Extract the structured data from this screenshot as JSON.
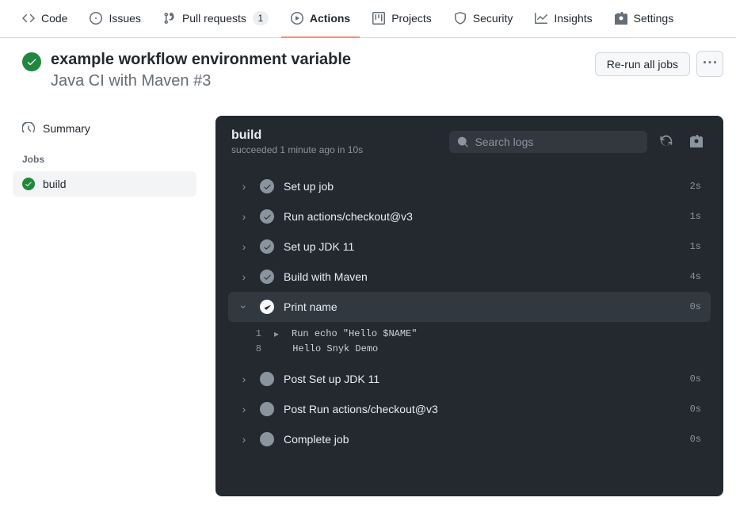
{
  "nav": {
    "code": "Code",
    "issues": "Issues",
    "pulls": "Pull requests",
    "pulls_count": "1",
    "actions": "Actions",
    "projects": "Projects",
    "security": "Security",
    "insights": "Insights",
    "settings": "Settings"
  },
  "header": {
    "title": "example workflow environment variable",
    "subtitle": "Java CI with Maven #3",
    "rerun": "Re-run all jobs"
  },
  "sidebar": {
    "summary": "Summary",
    "jobs_label": "Jobs",
    "build": "build"
  },
  "log": {
    "job_title": "build",
    "job_status": "succeeded 1 minute ago in 10s",
    "search_placeholder": "Search logs",
    "steps": [
      {
        "name": "Set up job",
        "dur": "2s"
      },
      {
        "name": "Run actions/checkout@v3",
        "dur": "1s"
      },
      {
        "name": "Set up JDK 11",
        "dur": "1s"
      },
      {
        "name": "Build with Maven",
        "dur": "4s"
      },
      {
        "name": "Print name",
        "dur": "0s"
      },
      {
        "name": "Post Set up JDK 11",
        "dur": "0s"
      },
      {
        "name": "Post Run actions/checkout@v3",
        "dur": "0s"
      },
      {
        "name": "Complete job",
        "dur": "0s"
      }
    ],
    "lines": {
      "l1_num": "1",
      "l1_txt": "Run echo \"Hello $NAME\"",
      "l2_num": "8",
      "l2_txt": "Hello Snyk Demo"
    }
  }
}
